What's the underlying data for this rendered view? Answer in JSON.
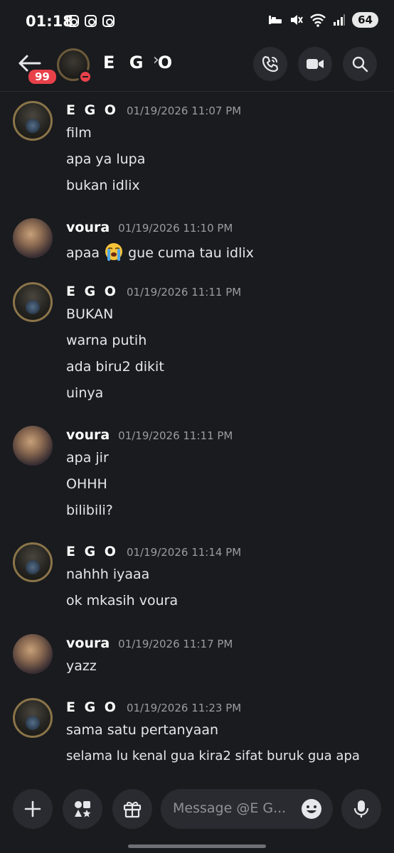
{
  "status_bar": {
    "time": "01:18",
    "battery": "64"
  },
  "header": {
    "unread_count": "99",
    "title": "E G O",
    "chevron": "›"
  },
  "composer": {
    "placeholder": "Message @E G..."
  },
  "messages": [
    {
      "author": "E G O",
      "timestamp": "01/19/2026 11:07 PM",
      "lines": [
        "film",
        "apa ya lupa",
        "bukan idlix"
      ]
    },
    {
      "author": "voura",
      "timestamp": "01/19/2026 11:10 PM",
      "line_before_emoji": "apaa",
      "emoji": "loudly-crying-face",
      "line_after_emoji": "gue cuma tau idlix"
    },
    {
      "author": "E G O",
      "timestamp": "01/19/2026 11:11 PM",
      "lines": [
        "BUKAN",
        "warna putih",
        "ada biru2 dikit",
        "uinya"
      ]
    },
    {
      "author": "voura",
      "timestamp": "01/19/2026 11:11 PM",
      "lines": [
        "apa jir",
        "OHHH",
        "bilibili?"
      ]
    },
    {
      "author": "E G O",
      "timestamp": "01/19/2026 11:14 PM",
      "lines": [
        "nahhh iyaaa",
        "ok mkasih voura"
      ]
    },
    {
      "author": "voura",
      "timestamp": "01/19/2026 11:17 PM",
      "lines": [
        "yazz"
      ]
    },
    {
      "author": "E G O",
      "timestamp": "01/19/2026 11:23 PM",
      "lines": [
        "sama satu pertanyaan",
        "selama lu kenal gua kira2 sifat buruk gua apa"
      ]
    }
  ],
  "colors": {
    "background": "#1a1b1e",
    "button_bg": "#2a2b30",
    "badge": "#e8414a",
    "timestamp": "#9a9ca3",
    "text": "#e6e7ea"
  }
}
